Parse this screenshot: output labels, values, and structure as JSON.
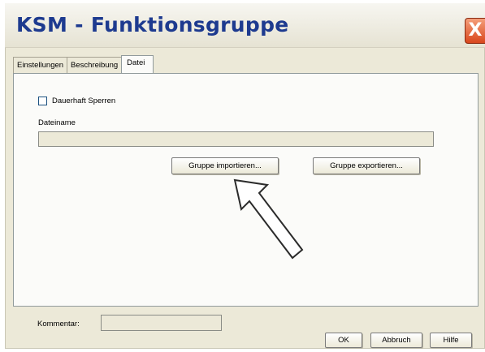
{
  "window": {
    "title": "KSM - Funktionsgruppe",
    "close_glyph": "X"
  },
  "tabs": [
    {
      "label": "Einstellungen"
    },
    {
      "label": "Beschreibung"
    },
    {
      "label": "Datei"
    }
  ],
  "panel": {
    "checkbox_label": "Dauerhaft Sperren",
    "filename_label": "Dateiname",
    "filename_value": "",
    "import_label": "Gruppe importieren...",
    "export_label": "Gruppe exportieren..."
  },
  "footer": {
    "comment_label": "Kommentar:",
    "comment_value": "",
    "ok_label": "OK",
    "cancel_label": "Abbruch",
    "help_label": "Hilfe"
  },
  "colors": {
    "title": "#1d3a8f",
    "close": "#d9471d",
    "dialog_bg": "#ece9d8"
  },
  "icons": {
    "close": "close-icon",
    "annotation": "arrow-pointer-icon"
  }
}
